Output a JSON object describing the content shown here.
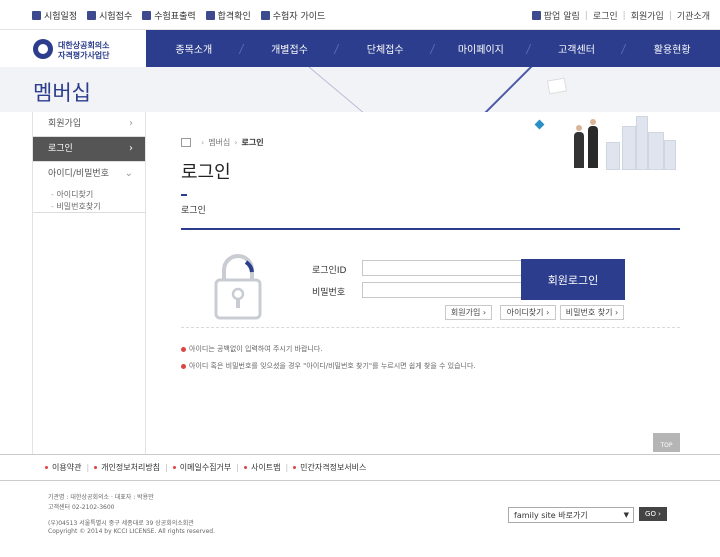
{
  "top_links": [
    {
      "label": "시험일정",
      "icon": "calendar-icon"
    },
    {
      "label": "시험접수",
      "icon": "register-icon"
    },
    {
      "label": "수험표출력",
      "icon": "print-icon"
    },
    {
      "label": "합격확인",
      "icon": "pass-check-icon"
    },
    {
      "label": "수험자 가이드",
      "icon": "guide-icon"
    }
  ],
  "util_links": {
    "popup": "팝업 알림",
    "login": "로그인",
    "join": "회원가입",
    "org": "기관소개"
  },
  "logo": {
    "line1": "대한상공회의소",
    "line2": "자격평가사업단"
  },
  "gnb": [
    "종목소개",
    "개별접수",
    "단체접수",
    "마이페이지",
    "고객센터",
    "활용현황"
  ],
  "visual_title": "멤버십",
  "lnb": {
    "items": [
      {
        "label": "회원가입"
      },
      {
        "label": "로그인"
      },
      {
        "label": "아이디/비밀번호"
      }
    ],
    "sub": [
      "아이디찾기",
      "비밀번호찾기"
    ]
  },
  "breadcrumb": {
    "parent": "멤버십",
    "current": "로그인"
  },
  "page_title": "로그인",
  "subhead": "로그인",
  "form": {
    "id_label": "로그인ID",
    "pw_label": "비밀번호",
    "id_value": "",
    "pw_value": "",
    "login_button": "회원로그인",
    "join_button": "회원가입",
    "find_id_button": "아이디찾기",
    "find_pw_button": "비밀번호 찾기"
  },
  "notes": [
    "아이디는 공백없이 입력하여 주시기 바랍니다.",
    "아이디 혹은 비밀번호를 잊으셨을 경우 \"아이디/비밀번호 찾기\"를 누르시면 쉽게 찾을 수 있습니다."
  ],
  "top_button": "TOP",
  "footer_links": [
    "이용약관",
    "개인정보처리방침",
    "이메일수집거부",
    "사이트맵",
    "민간자격정보서비스"
  ],
  "footer_info": {
    "line1": "기관명 : 대한상공회의소  ·  대표자 : 박용만",
    "line2": "고객센터 02-2102-3600",
    "line3": "(우)04513 서울특별시 중구 세종대로 39 상공회의소회관",
    "line4": "Copyright © 2014 by KCCI LICENSE. All rights reserved."
  },
  "family_site": {
    "placeholder": "family site 바로가기",
    "go": "GO"
  },
  "colors": {
    "brand": "#2b3d8c",
    "accent": "#dd4444"
  }
}
